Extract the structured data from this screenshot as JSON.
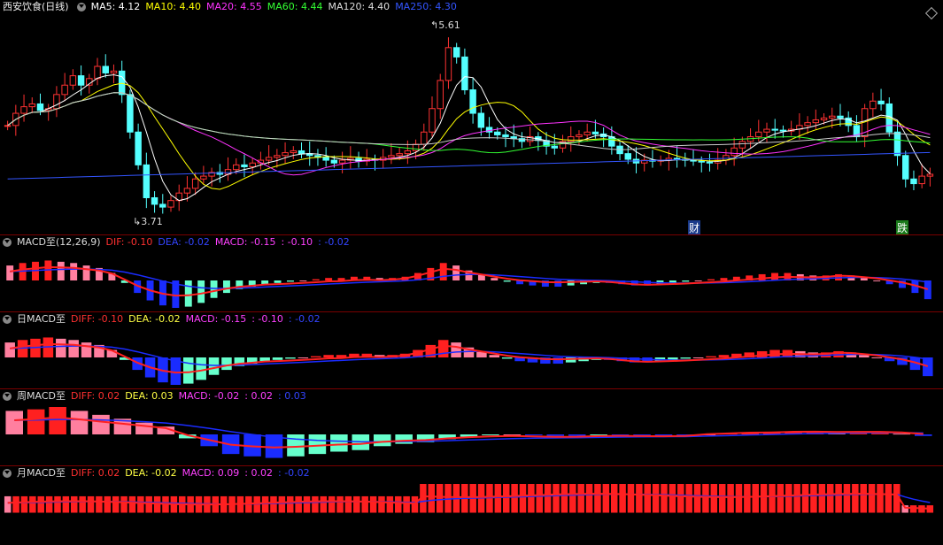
{
  "colors": {
    "up": "#ff3232",
    "upLight": "#ff8080",
    "down": "#54ffff",
    "dif": "#ff2020",
    "dea": "#1a2cff",
    "barPos": "#ff2020",
    "barPosLight": "#ff7f9f",
    "barNeg": "#1a2cff",
    "barNegLight": "#66ffcc"
  },
  "header": {
    "title": "西安饮食(日线)",
    "ma": [
      {
        "label": "MA5: 4.12",
        "color": "#ffffff"
      },
      {
        "label": "MA10: 4.40",
        "color": "#ffff00"
      },
      {
        "label": "MA20: 4.55",
        "color": "#ff33ff"
      },
      {
        "label": "MA60: 4.44",
        "color": "#33ff33"
      },
      {
        "label": "MA120: 4.40",
        "color": "#dddddd"
      },
      {
        "label": "MA250: 4.30",
        "color": "#3355ff"
      }
    ]
  },
  "annotations": {
    "high": "5.61",
    "low": "3.71",
    "tag1": "财",
    "tag2": "跌"
  },
  "macd1": {
    "name": "MACD至(12,26,9)",
    "dif": "DIF: -0.10",
    "dea": "DEA: -0.02",
    "macd": "MACD: -0.15",
    "extra1": ": -0.10",
    "extra2": ": -0.02"
  },
  "macd2": {
    "name": "日MACD至",
    "dif": "DIFF: -0.10",
    "dea": "DEA: -0.02",
    "macd": "MACD: -0.15",
    "extra1": ": -0.10",
    "extra2": ": -0.02"
  },
  "macd3": {
    "name": "周MACD至",
    "dif": "DIFF: 0.02",
    "dea": "DEA: 0.03",
    "macd": "MACD: -0.02",
    "extra1": ": 0.02",
    "extra2": ": 0.03"
  },
  "macd4": {
    "name": "月MACD至",
    "dif": "DIFF: 0.02",
    "dea": "DEA: -0.02",
    "macd": "MACD: 0.09",
    "extra1": ": 0.02",
    "extra2": ": -0.02"
  },
  "chart_data": {
    "type": "candlestick",
    "series_ma_names": [
      "MA5",
      "MA10",
      "MA20",
      "MA60",
      "MA120",
      "MA250"
    ],
    "ma_latest": [
      4.12,
      4.4,
      4.55,
      4.44,
      4.4,
      4.3
    ],
    "price_high_marker": 5.61,
    "price_low_marker": 3.71,
    "closes": [
      4.62,
      4.75,
      4.82,
      4.85,
      4.78,
      4.8,
      4.95,
      5.05,
      5.15,
      5.05,
      5.12,
      5.25,
      5.18,
      5.2,
      4.95,
      4.55,
      4.2,
      3.85,
      3.78,
      3.75,
      3.82,
      3.9,
      3.95,
      4.05,
      4.08,
      4.12,
      4.1,
      4.15,
      4.2,
      4.18,
      4.22,
      4.25,
      4.28,
      4.3,
      4.33,
      4.35,
      4.32,
      4.3,
      4.28,
      4.25,
      4.22,
      4.25,
      4.27,
      4.24,
      4.26,
      4.25,
      4.28,
      4.3,
      4.32,
      4.35,
      4.42,
      4.55,
      4.8,
      5.1,
      5.45,
      5.35,
      5.0,
      4.75,
      4.6,
      4.55,
      4.52,
      4.5,
      4.48,
      4.45,
      4.5,
      4.46,
      4.4,
      4.38,
      4.45,
      4.5,
      4.52,
      4.55,
      4.53,
      4.5,
      4.4,
      4.32,
      4.26,
      4.22,
      4.25,
      4.24,
      4.25,
      4.27,
      4.26,
      4.25,
      4.24,
      4.23,
      4.22,
      4.25,
      4.3,
      4.38,
      4.45,
      4.5,
      4.55,
      4.58,
      4.57,
      4.56,
      4.58,
      4.62,
      4.65,
      4.68,
      4.7,
      4.72,
      4.7,
      4.62,
      4.5,
      4.8,
      4.88,
      4.85,
      4.55,
      4.3,
      4.05,
      4.0,
      4.08,
      4.1
    ],
    "macd_daily": [
      0.12,
      0.14,
      0.15,
      0.16,
      0.15,
      0.14,
      0.12,
      0.1,
      0.06,
      -0.02,
      -0.1,
      -0.16,
      -0.2,
      -0.22,
      -0.21,
      -0.18,
      -0.14,
      -0.1,
      -0.07,
      -0.05,
      -0.03,
      -0.02,
      -0.01,
      0.0,
      0.01,
      0.02,
      0.02,
      0.03,
      0.03,
      0.02,
      0.02,
      0.03,
      0.06,
      0.1,
      0.14,
      0.12,
      0.08,
      0.05,
      0.02,
      -0.01,
      -0.03,
      -0.04,
      -0.05,
      -0.05,
      -0.04,
      -0.03,
      -0.02,
      -0.02,
      -0.03,
      -0.04,
      -0.04,
      -0.03,
      -0.02,
      -0.01,
      0.0,
      0.01,
      0.02,
      0.03,
      0.04,
      0.05,
      0.06,
      0.06,
      0.05,
      0.04,
      0.04,
      0.05,
      0.04,
      0.02,
      0.0,
      -0.03,
      -0.06,
      -0.1,
      -0.15
    ],
    "macd_weekly": [
      0.3,
      0.32,
      0.35,
      0.3,
      0.25,
      0.2,
      0.15,
      0.1,
      -0.05,
      -0.15,
      -0.25,
      -0.28,
      -0.3,
      -0.28,
      -0.25,
      -0.22,
      -0.2,
      -0.15,
      -0.12,
      -0.1,
      -0.06,
      -0.03,
      -0.01,
      0.0,
      -0.01,
      -0.02,
      -0.02,
      -0.01,
      -0.01,
      -0.02,
      -0.03,
      -0.03,
      0.0,
      0.01,
      0.02,
      0.02,
      0.03,
      0.03,
      0.02,
      0.02,
      0.02,
      0.01,
      -0.02
    ],
    "macd_monthly": [
      0.2,
      0.2,
      0.2,
      0.2,
      0.2,
      0.2,
      0.2,
      0.2,
      0.2,
      0.2,
      0.2,
      0.2,
      0.2,
      0.2,
      0.2,
      0.2,
      0.2,
      0.2,
      0.2,
      0.2,
      0.2,
      0.2,
      0.2,
      0.2,
      0.2,
      0.2,
      0.2,
      0.2,
      0.2,
      0.2,
      0.2,
      0.2,
      0.2,
      0.2,
      0.2,
      0.2,
      0.2,
      0.2,
      0.2,
      0.2,
      0.2,
      0.2,
      0.2,
      0.2,
      0.2,
      0.2,
      0.2,
      0.2,
      0.2,
      0.2,
      0.35,
      0.35,
      0.35,
      0.35,
      0.35,
      0.35,
      0.35,
      0.35,
      0.35,
      0.35,
      0.35,
      0.35,
      0.35,
      0.35,
      0.35,
      0.35,
      0.35,
      0.35,
      0.35,
      0.35,
      0.35,
      0.35,
      0.35,
      0.35,
      0.35,
      0.35,
      0.35,
      0.35,
      0.35,
      0.35,
      0.35,
      0.35,
      0.35,
      0.35,
      0.35,
      0.35,
      0.35,
      0.35,
      0.35,
      0.35,
      0.35,
      0.35,
      0.35,
      0.35,
      0.35,
      0.35,
      0.35,
      0.35,
      0.35,
      0.35,
      0.35,
      0.35,
      0.35,
      0.35,
      0.35,
      0.35,
      0.35,
      0.35,
      0.09,
      0.09,
      0.09,
      0.09
    ]
  }
}
